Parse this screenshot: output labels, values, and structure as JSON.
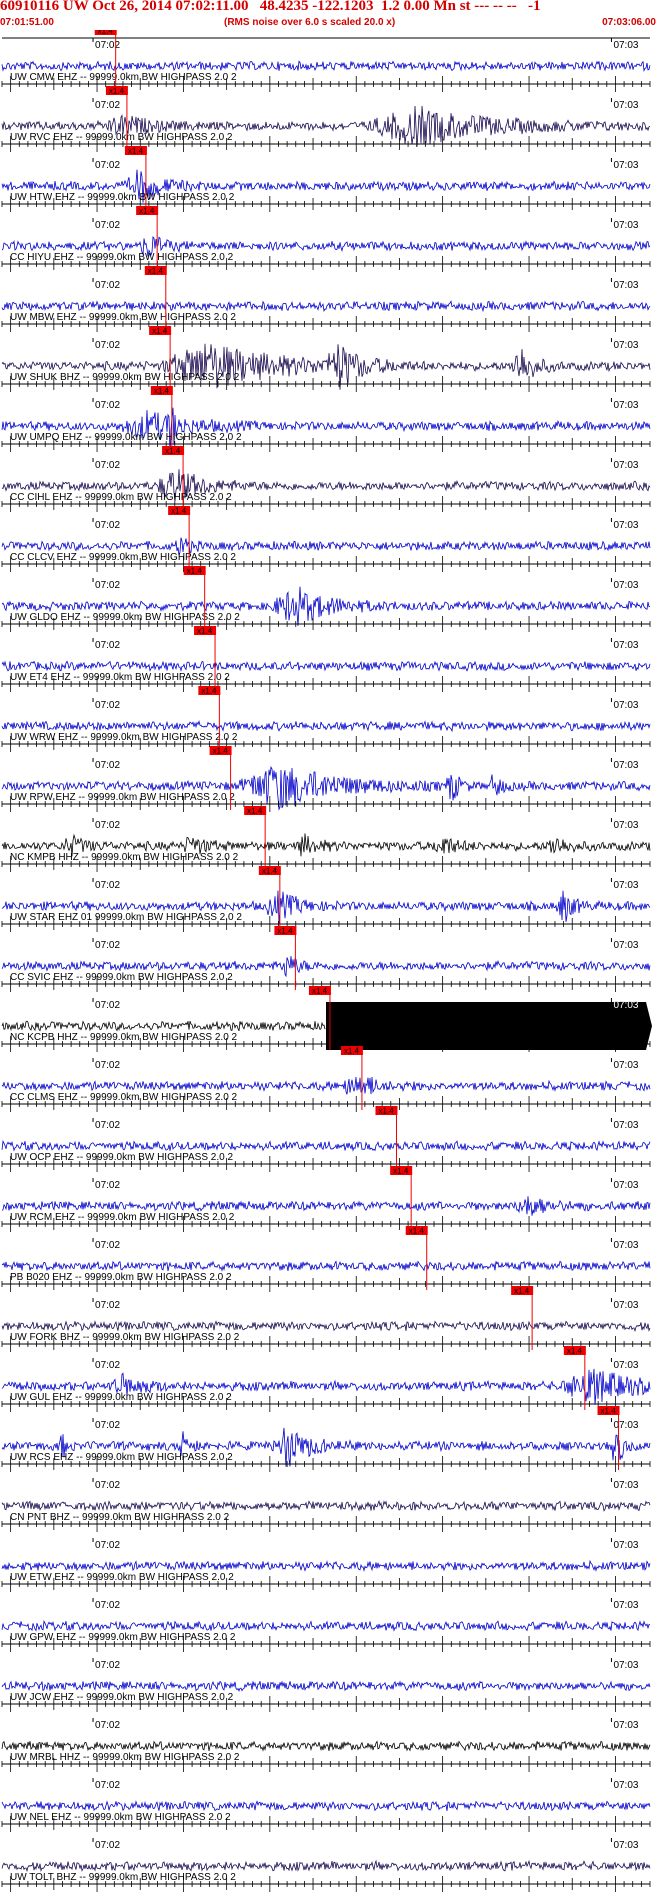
{
  "header": {
    "title": "60910116 UW Oct 26, 2014 07:02:11.00   48.4235 -122.1203  1.2 0.00 Mn st --- -- --   -1",
    "start_time": "07:01:51.00",
    "rms_note": "(RMS noise over 6.0 s scaled 20.0 x)",
    "end_time": "07:03:06.00"
  },
  "colors": {
    "trace_blue": "#0000cc",
    "trace_navy": "#1a0a50",
    "trace_black": "#000000",
    "pick": "#ee0000",
    "header_red": "#d40000"
  },
  "chart_data": {
    "type": "line",
    "x_range_seconds": [
      0,
      75
    ],
    "time_ticks": [
      {
        "t": 11,
        "label": "07:02"
      },
      {
        "t": 71,
        "label": "07:03"
      }
    ],
    "pick_label": "x1.4",
    "traces": [
      {
        "label": "UW CMW EHZ -- 99999.0km BW  HIGHPASS  2.0  2",
        "pick_t": 12.0,
        "color": "blue",
        "bursts": []
      },
      {
        "label": "UW RVC EHZ -- 99999.0km BW  HIGHPASS  2.0  2",
        "pick_t": 13.3,
        "color": "navy",
        "bursts": [
          {
            "t": 14,
            "w": 4,
            "a": 0.4
          },
          {
            "t": 48,
            "w": 10,
            "a": 0.8
          }
        ]
      },
      {
        "label": "UW HTW EHZ -- 99999.0km BW  HIGHPASS  2.0  2",
        "pick_t": 15.5,
        "color": "blue",
        "bursts": [
          {
            "t": 16,
            "w": 3,
            "a": 0.7
          }
        ]
      },
      {
        "label": "CC HIYU EHZ -- 99999.0km BW  HIGHPASS  2.0  2",
        "pick_t": 16.8,
        "color": "blue",
        "bursts": [
          {
            "t": 17,
            "w": 2,
            "a": 0.5
          }
        ]
      },
      {
        "label": "UW MBW EHZ -- 99999.0km BW  HIGHPASS  2.0  2",
        "pick_t": 17.8,
        "color": "blue",
        "bursts": []
      },
      {
        "label": "UW SHUK BHZ -- 99999.0km BW  HIGHPASS  2.0  2",
        "pick_t": 18.3,
        "color": "navy",
        "bursts": [
          {
            "t": 24,
            "w": 10,
            "a": 1.0
          },
          {
            "t": 39,
            "w": 3,
            "a": 0.9
          },
          {
            "t": 60,
            "w": 2,
            "a": 0.9
          }
        ]
      },
      {
        "label": "UW UMPQ EHZ -- 99999.0km BW  HIGHPASS  2.0  2",
        "pick_t": 18.5,
        "color": "blue",
        "bursts": [
          {
            "t": 17,
            "w": 6,
            "a": 0.6
          },
          {
            "t": 19.5,
            "w": 0.6,
            "a": 1.0
          }
        ]
      },
      {
        "label": "CC CIHL EHZ -- 99999.0km BW  HIGHPASS  2.0  2",
        "pick_t": 19.8,
        "color": "navy",
        "bursts": [
          {
            "t": 20,
            "w": 4,
            "a": 0.7
          }
        ]
      },
      {
        "label": "CC CLCV EHZ -- 99999.0km BW  HIGHPASS  2.0  2",
        "pick_t": 20.5,
        "color": "blue",
        "bursts": [
          {
            "t": 20.7,
            "w": 1,
            "a": 0.5
          }
        ]
      },
      {
        "label": "UW GLDO EHZ -- 99999.0km BW  HIGHPASS  2.0  2",
        "pick_t": 22.3,
        "color": "blue",
        "bursts": [
          {
            "t": 34,
            "w": 5,
            "a": 0.8
          }
        ]
      },
      {
        "label": "UW ET4 EHZ -- 99999.0km BW  HIGHPASS  2.0  2",
        "pick_t": 23.5,
        "color": "blue",
        "bursts": []
      },
      {
        "label": "UW WRW EHZ -- 99999.0km BW  HIGHPASS  2.0  2",
        "pick_t": 24.0,
        "color": "blue",
        "bursts": []
      },
      {
        "label": "UW RPW EHZ -- 99999.0km BW  HIGHPASS  2.0  2",
        "pick_t": 25.3,
        "color": "blue",
        "bursts": [
          {
            "t": 32,
            "w": 8,
            "a": 1.0
          },
          {
            "t": 52,
            "w": 1,
            "a": 0.8
          },
          {
            "t": 57,
            "w": 1,
            "a": 0.6
          }
        ]
      },
      {
        "label": "NC KMPB HHZ -- 99999.0km BW  HIGHPASS  2.0  2",
        "pick_t": 29.3,
        "color": "black",
        "bursts": [
          {
            "t": 8,
            "w": 2,
            "a": 0.4
          },
          {
            "t": 22,
            "w": 2,
            "a": 0.4
          },
          {
            "t": 35,
            "w": 2,
            "a": 0.4
          },
          {
            "t": 51,
            "w": 2,
            "a": 0.4
          },
          {
            "t": 64,
            "w": 2,
            "a": 0.4
          }
        ]
      },
      {
        "label": "UW STAR EHZ 01 99999.0km BW  HIGHPASS  2.0  2",
        "pick_t": 31.0,
        "color": "blue",
        "bursts": [
          {
            "t": 32,
            "w": 3,
            "a": 0.6
          },
          {
            "t": 65,
            "w": 1.5,
            "a": 0.7
          }
        ]
      },
      {
        "label": "CC SVIC EHZ -- 99999.0km BW  HIGHPASS  2.0  2",
        "pick_t": 32.8,
        "color": "blue",
        "bursts": [
          {
            "t": 33,
            "w": 1.5,
            "a": 0.5
          }
        ]
      },
      {
        "label": "NC KCPB HHZ -- 99999.0km BW  HIGHPASS  2.0  2",
        "pick_t": 36.8,
        "color": "black",
        "bursts": [],
        "saturated_from": 37.5
      },
      {
        "label": "CC CLMS EHZ -- 99999.0km BW  HIGHPASS  2.0  2",
        "pick_t": 40.5,
        "color": "blue",
        "bursts": [
          {
            "t": 41,
            "w": 3,
            "a": 0.5
          }
        ]
      },
      {
        "label": "UW OCP EHZ -- 99999.0km BW  HIGHPASS  2.0  2",
        "pick_t": 44.5,
        "color": "blue",
        "bursts": []
      },
      {
        "label": "UW RCM EHZ -- 99999.0km BW  HIGHPASS  2.0  2",
        "pick_t": 46.2,
        "color": "blue",
        "bursts": [
          {
            "t": 61,
            "w": 3,
            "a": 0.4
          }
        ]
      },
      {
        "label": "PB B020 EHZ -- 99999.0km BW  HIGHPASS  2.0  2",
        "pick_t": 48.0,
        "color": "blue",
        "bursts": []
      },
      {
        "label": "UW FORK BHZ -- 99999.0km BW  HIGHPASS  2.0  2",
        "pick_t": 60.2,
        "color": "navy",
        "bursts": []
      },
      {
        "label": "UW GUL EHZ -- 99999.0km BW  HIGHPASS  2.0  2",
        "pick_t": 66.3,
        "color": "blue",
        "bursts": [
          {
            "t": 68,
            "w": 6,
            "a": 0.8
          },
          {
            "t": 14,
            "w": 3,
            "a": 0.4
          }
        ]
      },
      {
        "label": "UW RCS EHZ -- 99999.0km BW  HIGHPASS  2.0  2",
        "pick_t": 70.2,
        "color": "blue",
        "bursts": [
          {
            "t": 7,
            "w": 0.6,
            "a": 0.6
          },
          {
            "t": 21,
            "w": 1,
            "a": 0.7
          },
          {
            "t": 33,
            "w": 3,
            "a": 0.9
          },
          {
            "t": 71,
            "w": 1,
            "a": 1.0
          }
        ]
      },
      {
        "label": "CN PNT BHZ -- 99999.0km BW  HIGHPASS  2.0  2",
        "pick_t": null,
        "color": "navy",
        "bursts": []
      },
      {
        "label": "UW ETW EHZ -- 99999.0km BW  HIGHPASS  2.0  2",
        "pick_t": null,
        "color": "blue",
        "bursts": []
      },
      {
        "label": "UW GPW EHZ -- 99999.0km BW  HIGHPASS  2.0  2",
        "pick_t": null,
        "color": "blue",
        "bursts": []
      },
      {
        "label": "UW JCW EHZ -- 99999.0km BW  HIGHPASS  2.0  2",
        "pick_t": null,
        "color": "blue",
        "bursts": []
      },
      {
        "label": "UW MRBL HHZ -- 99999.0km BW  HIGHPASS  2.0  2",
        "pick_t": null,
        "color": "black",
        "bursts": []
      },
      {
        "label": "UW NEL EHZ -- 99999.0km BW  HIGHPASS  2.0  2",
        "pick_t": null,
        "color": "blue",
        "bursts": []
      },
      {
        "label": "UW TOLT BHZ -- 99999.0km BW  HIGHPASS  2.0  2",
        "pick_t": null,
        "color": "navy",
        "bursts": []
      }
    ]
  }
}
